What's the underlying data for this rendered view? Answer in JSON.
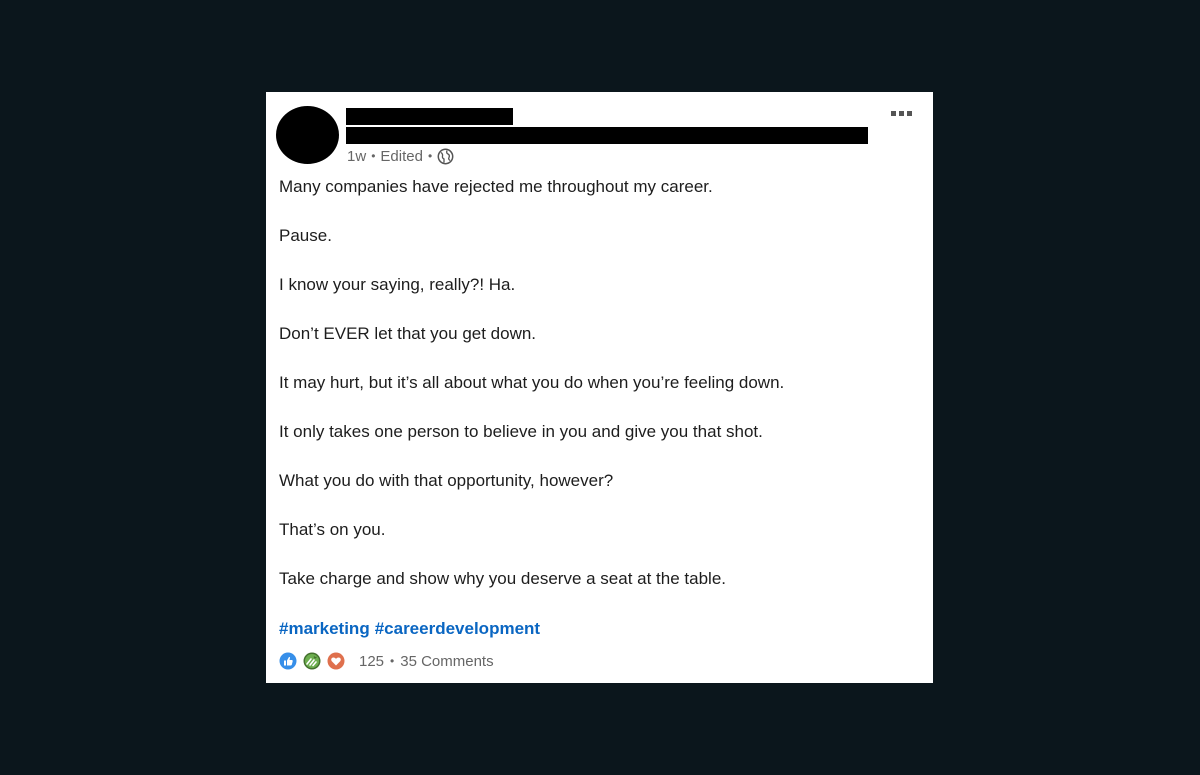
{
  "post": {
    "timestamp": "1w",
    "edited_label": "Edited",
    "visibility_icon": "globe-icon",
    "body_lines": [
      "Many companies have rejected me throughout my career.",
      "Pause.",
      "I know your saying, really?! Ha.",
      "Don’t EVER let that you get down.",
      "It may hurt, but it’s all about what you do when you’re feeling down.",
      "It only takes one person to believe in you and give you that shot.",
      "What you do with that opportunity, however?",
      "That’s on you.",
      "Take charge and show why you deserve a seat at the table."
    ],
    "hashtags": [
      "#marketing",
      "#careerdevelopment"
    ]
  },
  "social": {
    "reactions": [
      "like-icon",
      "celebrate-icon",
      "love-icon"
    ],
    "reaction_count": "125",
    "separator": "•",
    "comments_label": "35 Comments"
  },
  "colors": {
    "background": "#0b161c",
    "card": "#ffffff",
    "link": "#0a66c2",
    "meta_text": "#666666",
    "body_text": "#1d1d1d"
  }
}
